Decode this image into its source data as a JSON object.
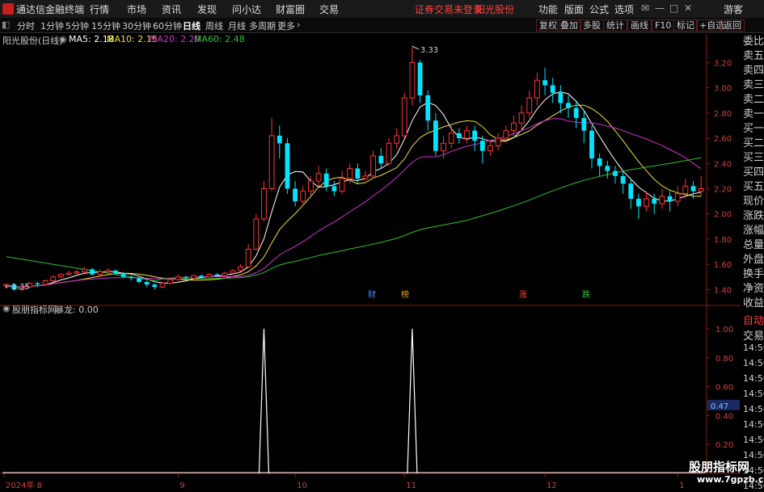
{
  "menubar": {
    "app_title": "通达信金融终端",
    "menus": [
      "行情",
      "市场",
      "资讯",
      "发现",
      "问小达",
      "财富圈",
      "交易"
    ],
    "status": "证券交易未登录",
    "stock_name": "阳光股份",
    "right_menus": [
      "功能",
      "版面",
      "公式",
      "选项"
    ],
    "user": "游客"
  },
  "toolbar": {
    "periods": [
      "分时",
      "1分钟",
      "5分钟",
      "15分钟",
      "30分钟",
      "60分钟",
      "日线",
      "周线",
      "月线",
      "多周期",
      "更多"
    ],
    "active_period": "日线",
    "right_buttons": [
      "复权",
      "叠加",
      "多股",
      "统计",
      "画线",
      "F10",
      "标记",
      "+自选",
      "返回"
    ]
  },
  "main_chart_info": {
    "title": "阳光股份(日线)",
    "ma5": "MA5: 2.18",
    "ma10": "MA10: 2.15",
    "ma20": "MA20: 2.20",
    "ma60": "MA60: 2.48",
    "high_label": "3.33",
    "low_label": "1.35"
  },
  "y_axis_ticks": [
    "3.20",
    "3.00",
    "2.80",
    "2.60",
    "2.40",
    "2.20",
    "2.00",
    "1.80",
    "1.60",
    "1.40"
  ],
  "info_tags": [
    {
      "text": "财",
      "color": "#4a8cff"
    },
    {
      "text": "榜",
      "color": "#e0a020"
    },
    {
      "text": "涨",
      "color": "#ff4040"
    },
    {
      "text": "跌",
      "color": "#2ecc40"
    }
  ],
  "right_panel": [
    "委比",
    "卖五",
    "卖四",
    "卖三",
    "卖二",
    "卖一",
    "买一",
    "买二",
    "买三",
    "买四",
    "买五",
    "现价",
    "涨跌",
    "涨幅",
    "总量",
    "外盘",
    "换手",
    "净资",
    "收益"
  ],
  "indicator_info": {
    "title": "股朋指标网",
    "value": "暴龙: 0.00",
    "current_value_badge": "0.47"
  },
  "indicator_axis_ticks": [
    "1.00",
    "0.80",
    "0.60",
    "0.40",
    "0.20"
  ],
  "right_panel2": [
    "自动",
    "交易",
    "14:56",
    "14:56",
    "14:56",
    "14:56",
    "14:56",
    "14:56",
    "14:56",
    "14:56",
    "14:56",
    "14:56"
  ],
  "x_axis_labels": [
    "2024年 8",
    "9",
    "10",
    "11",
    "12",
    "1"
  ],
  "watermark": {
    "line1": "股朋指标网",
    "line2": "www.7gpzb.com"
  },
  "colors": {
    "up": "#ff3333",
    "down": "#00e5ff",
    "ma5": "#ffffff",
    "ma10": "#f0e030",
    "ma20": "#d030d0",
    "ma60": "#30c030",
    "axis": "#8b1a1a"
  },
  "chart_data": {
    "type": "candlestick",
    "ylim": [
      1.3,
      3.35
    ],
    "indicator_ylim": [
      0,
      1.05
    ],
    "candles": [
      [
        1.43,
        1.44,
        1.41,
        1.45
      ],
      [
        1.44,
        1.4,
        1.39,
        1.45
      ],
      [
        1.4,
        1.42,
        1.39,
        1.43
      ],
      [
        1.42,
        1.45,
        1.41,
        1.46
      ],
      [
        1.45,
        1.44,
        1.42,
        1.46
      ],
      [
        1.44,
        1.47,
        1.43,
        1.48
      ],
      [
        1.47,
        1.5,
        1.46,
        1.51
      ],
      [
        1.5,
        1.52,
        1.49,
        1.53
      ],
      [
        1.52,
        1.53,
        1.51,
        1.55
      ],
      [
        1.53,
        1.54,
        1.52,
        1.56
      ],
      [
        1.54,
        1.56,
        1.53,
        1.58
      ],
      [
        1.56,
        1.52,
        1.51,
        1.57
      ],
      [
        1.52,
        1.54,
        1.51,
        1.56
      ],
      [
        1.54,
        1.55,
        1.53,
        1.57
      ],
      [
        1.55,
        1.53,
        1.52,
        1.56
      ],
      [
        1.53,
        1.5,
        1.49,
        1.54
      ],
      [
        1.5,
        1.49,
        1.47,
        1.51
      ],
      [
        1.49,
        1.46,
        1.45,
        1.5
      ],
      [
        1.46,
        1.44,
        1.42,
        1.47
      ],
      [
        1.44,
        1.42,
        1.4,
        1.45
      ],
      [
        1.42,
        1.45,
        1.41,
        1.46
      ],
      [
        1.45,
        1.48,
        1.44,
        1.49
      ],
      [
        1.48,
        1.5,
        1.47,
        1.52
      ],
      [
        1.5,
        1.49,
        1.48,
        1.51
      ],
      [
        1.49,
        1.51,
        1.48,
        1.52
      ],
      [
        1.51,
        1.5,
        1.49,
        1.52
      ],
      [
        1.5,
        1.52,
        1.49,
        1.53
      ],
      [
        1.52,
        1.51,
        1.5,
        1.53
      ],
      [
        1.51,
        1.53,
        1.5,
        1.54
      ],
      [
        1.53,
        1.55,
        1.52,
        1.56
      ],
      [
        1.55,
        1.58,
        1.54,
        1.6
      ],
      [
        1.58,
        1.72,
        1.57,
        1.76
      ],
      [
        1.72,
        1.96,
        1.71,
        2.0
      ],
      [
        1.96,
        2.2,
        1.94,
        2.26
      ],
      [
        2.2,
        2.62,
        2.18,
        2.76
      ],
      [
        2.62,
        2.56,
        2.44,
        2.7
      ],
      [
        2.56,
        2.2,
        2.16,
        2.6
      ],
      [
        2.2,
        2.1,
        2.06,
        2.26
      ],
      [
        2.1,
        2.18,
        2.06,
        2.22
      ],
      [
        2.18,
        2.26,
        2.14,
        2.3
      ],
      [
        2.26,
        2.32,
        2.22,
        2.38
      ],
      [
        2.32,
        2.22,
        2.18,
        2.36
      ],
      [
        2.22,
        2.18,
        2.14,
        2.26
      ],
      [
        2.18,
        2.28,
        2.16,
        2.34
      ],
      [
        2.28,
        2.36,
        2.24,
        2.4
      ],
      [
        2.36,
        2.28,
        2.24,
        2.4
      ],
      [
        2.28,
        2.3,
        2.26,
        2.34
      ],
      [
        2.3,
        2.46,
        2.28,
        2.5
      ],
      [
        2.46,
        2.4,
        2.36,
        2.52
      ],
      [
        2.4,
        2.56,
        2.38,
        2.6
      ],
      [
        2.56,
        2.62,
        2.52,
        2.68
      ],
      [
        2.62,
        2.92,
        2.6,
        2.96
      ],
      [
        2.92,
        3.2,
        2.86,
        3.33
      ],
      [
        3.2,
        2.94,
        2.88,
        3.22
      ],
      [
        2.94,
        2.74,
        2.66,
        2.98
      ],
      [
        2.74,
        2.5,
        2.46,
        2.8
      ],
      [
        2.5,
        2.56,
        2.44,
        2.62
      ],
      [
        2.56,
        2.64,
        2.52,
        2.7
      ],
      [
        2.64,
        2.6,
        2.56,
        2.68
      ],
      [
        2.6,
        2.66,
        2.56,
        2.7
      ],
      [
        2.66,
        2.58,
        2.5,
        2.7
      ],
      [
        2.58,
        2.5,
        2.4,
        2.62
      ],
      [
        2.5,
        2.54,
        2.46,
        2.58
      ],
      [
        2.54,
        2.6,
        2.5,
        2.64
      ],
      [
        2.6,
        2.66,
        2.56,
        2.7
      ],
      [
        2.66,
        2.72,
        2.62,
        2.78
      ],
      [
        2.72,
        2.8,
        2.66,
        2.86
      ],
      [
        2.8,
        2.92,
        2.76,
        2.98
      ],
      [
        2.92,
        3.06,
        2.86,
        3.12
      ],
      [
        3.06,
        3.02,
        2.94,
        3.16
      ],
      [
        3.02,
        2.96,
        2.88,
        3.08
      ],
      [
        2.96,
        2.88,
        2.8,
        3.02
      ],
      [
        2.88,
        2.84,
        2.76,
        2.94
      ],
      [
        2.84,
        2.76,
        2.68,
        2.9
      ],
      [
        2.76,
        2.66,
        2.56,
        2.82
      ],
      [
        2.66,
        2.44,
        2.36,
        2.7
      ],
      [
        2.44,
        2.38,
        2.3,
        2.48
      ],
      [
        2.38,
        2.34,
        2.28,
        2.42
      ],
      [
        2.34,
        2.3,
        2.24,
        2.38
      ],
      [
        2.3,
        2.24,
        2.16,
        2.34
      ],
      [
        2.24,
        2.12,
        2.04,
        2.28
      ],
      [
        2.12,
        2.06,
        1.96,
        2.16
      ],
      [
        2.06,
        2.12,
        2.02,
        2.18
      ],
      [
        2.12,
        2.08,
        2.0,
        2.16
      ],
      [
        2.08,
        2.14,
        2.04,
        2.2
      ],
      [
        2.14,
        2.1,
        2.02,
        2.18
      ],
      [
        2.1,
        2.16,
        2.06,
        2.22
      ],
      [
        2.16,
        2.22,
        2.12,
        2.28
      ],
      [
        2.22,
        2.18,
        2.12,
        2.26
      ],
      [
        2.18,
        2.2,
        2.14,
        2.3
      ]
    ],
    "signal_bars": [
      33,
      52
    ],
    "x_axis_positions": [
      0,
      22,
      37,
      51,
      69,
      86
    ]
  }
}
